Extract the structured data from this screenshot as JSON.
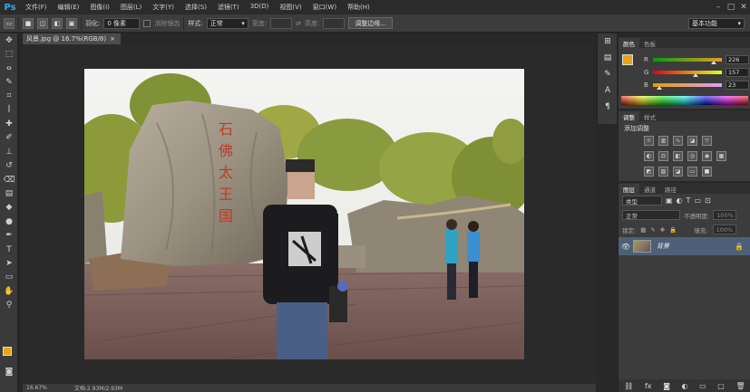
{
  "app": {
    "logo": "Ps"
  },
  "menu": [
    "文件(F)",
    "编辑(E)",
    "图像(I)",
    "图层(L)",
    "文字(Y)",
    "选择(S)",
    "滤镜(T)",
    "3D(D)",
    "视图(V)",
    "窗口(W)",
    "帮助(H)"
  ],
  "window_controls": [
    "minimize-icon",
    "maximize-icon",
    "close-icon"
  ],
  "options": {
    "feather_label": "羽化:",
    "feather_value": "0 像素",
    "antialias_label": "消除锯齿",
    "style_label": "样式:",
    "style_value": "正常",
    "width_label": "宽度:",
    "height_label": "高度:",
    "refine_edge": "调整边缘...",
    "workspace": "基本功能"
  },
  "document": {
    "tab_title": "风景.jpg @ 16.7%(RGB/8)",
    "zoom": "16.67%",
    "doc_info": "文档:2.93M/2.93M"
  },
  "color_panel": {
    "tabs": [
      "颜色",
      "色板"
    ],
    "fg_color": "#e8a317",
    "channels": [
      {
        "label": "R",
        "value": "226",
        "pos": 0.886
      },
      {
        "label": "G",
        "value": "157",
        "pos": 0.616
      },
      {
        "label": "B",
        "value": "23",
        "pos": 0.09
      }
    ]
  },
  "adjust_panel": {
    "tabs": [
      "调整",
      "样式"
    ],
    "title": "添加调整"
  },
  "layers_panel": {
    "tabs": [
      "图层",
      "通道",
      "路径"
    ],
    "kind_label": "类型",
    "blend_mode": "正常",
    "opacity_label": "不透明度:",
    "opacity_value": "100%",
    "lock_label": "锁定:",
    "fill_label": "填充:",
    "fill_value": "100%",
    "layers": [
      {
        "name": "背景",
        "locked": true,
        "visible": true
      }
    ]
  },
  "photo": {
    "stone_text": [
      "石",
      "佛",
      "太",
      "王",
      "国"
    ]
  }
}
